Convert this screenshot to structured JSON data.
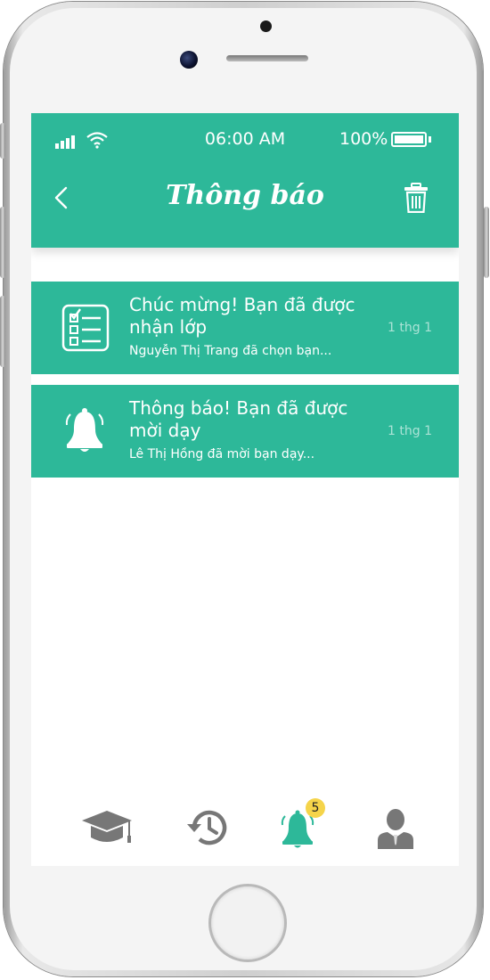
{
  "status_bar": {
    "time": "06:00 AM",
    "battery_percent": "100%",
    "battery_level": 1.0
  },
  "header": {
    "title": "Thông báo",
    "back_icon": "chevron-left-icon",
    "delete_icon": "trash-icon"
  },
  "notifications": [
    {
      "icon": "checklist-icon",
      "title": "Chúc mừng! Bạn đã được nhận lớp",
      "subtitle": "Nguyễn Thị Trang đã chọn bạn...",
      "time": "1 thg 1"
    },
    {
      "icon": "bell-ringing-icon",
      "title": "Thông báo! Bạn đã được mời dạy",
      "subtitle": "Lê Thị Hồng đã mời bạn dạy...",
      "time": "1 thg 1"
    }
  ],
  "tab_bar": {
    "tabs": [
      {
        "icon": "graduation-cap-icon",
        "active": false
      },
      {
        "icon": "history-icon",
        "active": false
      },
      {
        "icon": "bell-icon",
        "active": true
      },
      {
        "icon": "profile-icon",
        "active": false
      }
    ],
    "notification_badge": "5"
  },
  "colors": {
    "accent": "#2db899",
    "inactive_icon": "#777777",
    "badge": "#f5d44a"
  }
}
